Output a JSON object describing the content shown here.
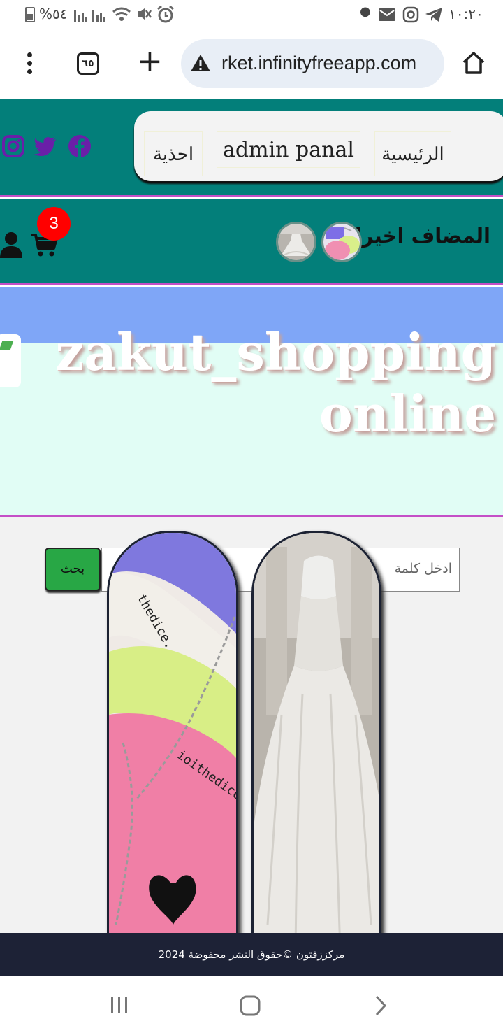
{
  "status_bar": {
    "battery_text": "%٥٤",
    "time": "١٠:٢٠"
  },
  "browser": {
    "tab_count": "٦٥",
    "url": "rket.infinityfreeapp.com"
  },
  "nav": {
    "home": "الرئيسية",
    "admin": "admin panal",
    "shoes": "احذية"
  },
  "recent": {
    "label": "المضاف اخيرا",
    "cart_count": "3"
  },
  "hero": {
    "title_line1": "zakut_shopping",
    "title_line2": "online"
  },
  "search": {
    "placeholder": "ادخل كلمة",
    "button": "بحث"
  },
  "footer": {
    "text": "مركززفتون ©حقوق النشر محفوضة 2024"
  },
  "icons": {
    "social": [
      "instagram-icon",
      "twitter-icon",
      "facebook-icon"
    ],
    "social_color": "#6a1fa8"
  },
  "colors": {
    "teal": "#037f7a",
    "accent_line": "#c44fc7",
    "hero_band": "#7fa6f7",
    "hero_bg": "#e1fdf5",
    "search_button": "#28a745",
    "badge": "#ff0000",
    "footer": "#1d2236"
  }
}
